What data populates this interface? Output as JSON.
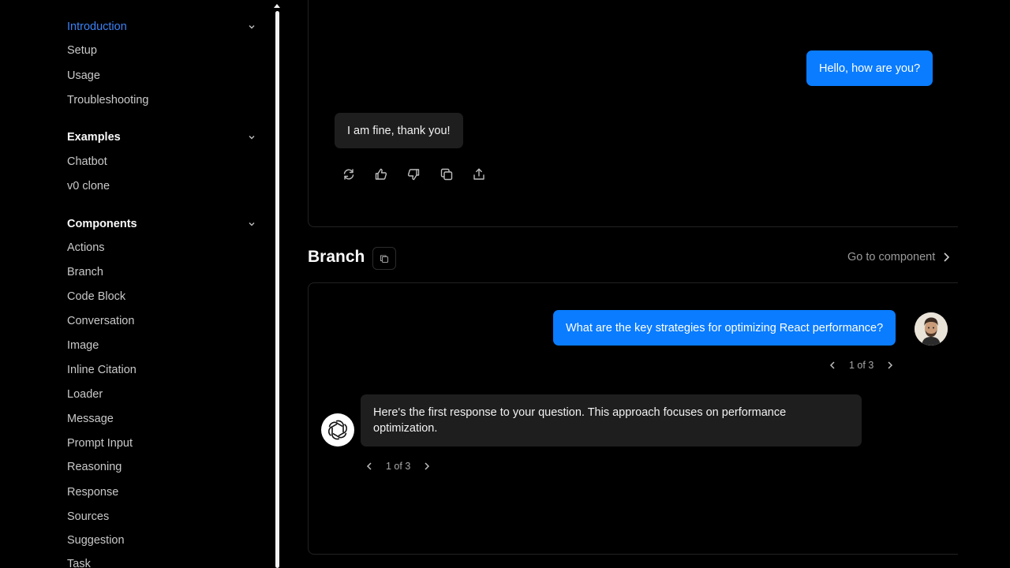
{
  "sidebar": {
    "sections": [
      {
        "title": "Introduction",
        "active": true,
        "items": [
          "Setup",
          "Usage",
          "Troubleshooting"
        ]
      },
      {
        "title": "Examples",
        "active": false,
        "items": [
          "Chatbot",
          "v0 clone"
        ]
      },
      {
        "title": "Components",
        "active": false,
        "items": [
          "Actions",
          "Branch",
          "Code Block",
          "Conversation",
          "Image",
          "Inline Citation",
          "Loader",
          "Message",
          "Prompt Input",
          "Reasoning",
          "Response",
          "Sources",
          "Suggestion",
          "Task"
        ]
      }
    ]
  },
  "actions_demo": {
    "user_message": "Hello, how are you?",
    "assistant_message": "I am fine, thank you!",
    "action_icons": [
      "retry-icon",
      "thumbs-up-icon",
      "thumbs-down-icon",
      "copy-icon",
      "share-icon"
    ]
  },
  "branch_section": {
    "title": "Branch",
    "goto_label": "Go to component",
    "user_message": "What are the key strategies for optimizing React performance?",
    "user_pager": "1 of 3",
    "assistant_message": "Here's the first response to your question. This approach focuses on performance optimization.",
    "assistant_pager": "1 of 3"
  },
  "colors": {
    "accent": "#3b82f6",
    "user_bubble": "#0a7cff",
    "assistant_bubble": "#1e1e1e",
    "background": "#000000"
  }
}
